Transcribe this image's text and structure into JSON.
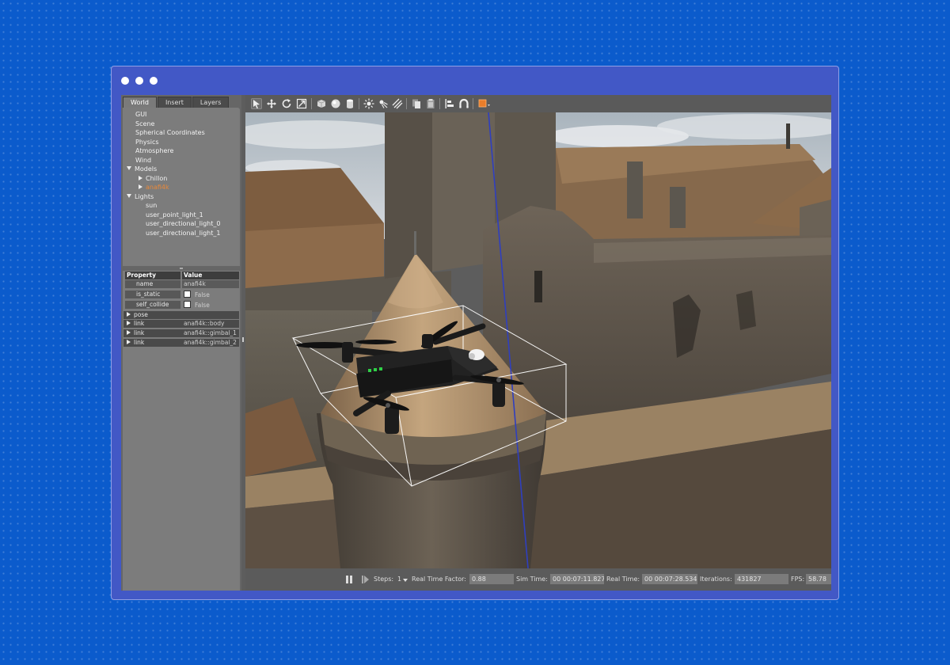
{
  "window": {
    "controls": [
      "dot-1",
      "dot-2",
      "dot-3"
    ]
  },
  "tabs": [
    "World",
    "Insert",
    "Layers"
  ],
  "tree": {
    "items": [
      "GUI",
      "Scene",
      "Spherical Coordinates",
      "Physics",
      "Atmosphere",
      "Wind"
    ],
    "models": {
      "label": "Models",
      "children": [
        "Chillon",
        "anafi4k"
      ]
    },
    "lights": {
      "label": "Lights",
      "children": [
        "sun",
        "user_point_light_1",
        "user_directional_light_0",
        "user_directional_light_1"
      ]
    }
  },
  "properties": {
    "header": {
      "property": "Property",
      "value": "Value"
    },
    "rows": [
      {
        "key": "name",
        "value": "anafi4k"
      },
      {
        "key": "is_static",
        "value": "False"
      },
      {
        "key": "self_collide",
        "value": "False"
      },
      {
        "key": "pose",
        "value": ""
      },
      {
        "key": "link",
        "value": "anafi4k::body"
      },
      {
        "key": "link",
        "value": "anafi4k::gimbal_1"
      },
      {
        "key": "link",
        "value": "anafi4k::gimbal_2"
      }
    ]
  },
  "toolbar": {
    "icons": [
      "select-mode-icon",
      "translate-mode-icon",
      "rotate-mode-icon",
      "scale-mode-icon",
      "box-icon",
      "sphere-icon",
      "cylinder-icon",
      "point-light-icon",
      "spot-light-icon",
      "directional-light-icon",
      "copy-icon",
      "paste-icon",
      "align-icon",
      "snap-icon",
      "view-angle-icon"
    ]
  },
  "status": {
    "pause_icon": "pause-icon",
    "step_icon": "step-icon",
    "steps_label": "Steps:",
    "steps_value": "1",
    "rtf_label": "Real Time Factor:",
    "rtf_value": "0.88",
    "sim_time_label": "Sim Time:",
    "sim_time_value": "00 00:07:11.827",
    "real_time_label": "Real Time:",
    "real_time_value": "00 00:07:28.534",
    "iterations_label": "Iterations:",
    "iterations_value": "431827",
    "fps_label": "FPS:",
    "fps_value": "58.78"
  },
  "colors": {
    "page_bg": "#0b5bcc",
    "window_frame": "#4258c6",
    "selected_model": "#e8883a",
    "panel_bg": "#7c7c7c",
    "toolbar_bg": "#5a5a5a"
  }
}
